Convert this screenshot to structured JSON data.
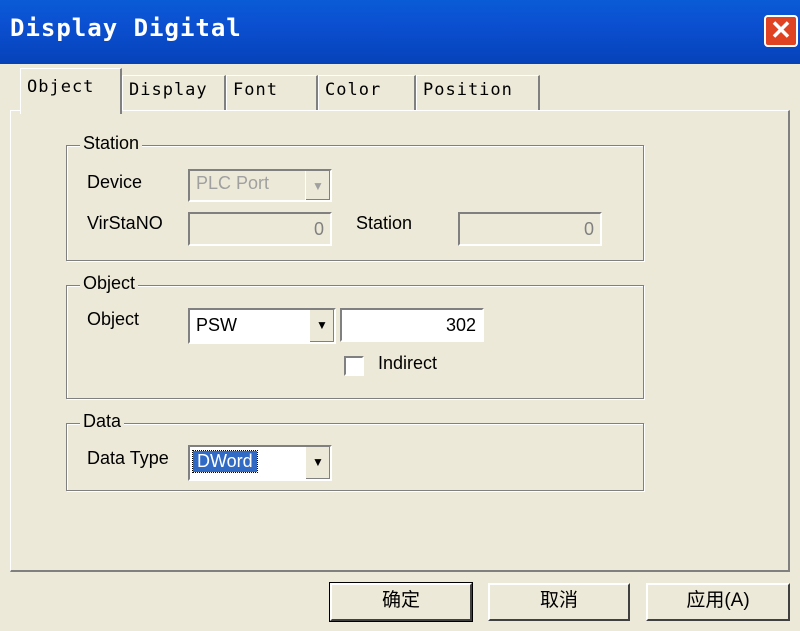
{
  "window": {
    "title": "Display Digital",
    "close_glyph": "✕"
  },
  "tabs": [
    {
      "label": "Object",
      "active": true
    },
    {
      "label": "Display",
      "active": false
    },
    {
      "label": "Font",
      "active": false
    },
    {
      "label": "Color",
      "active": false
    },
    {
      "label": "Position",
      "active": false
    }
  ],
  "station_group": {
    "legend": "Station",
    "device_label": "Device",
    "device_value": "PLC Port",
    "virstano_label": "VirStaNO",
    "virstano_value": "0",
    "station_label": "Station",
    "station_value": "0"
  },
  "object_group": {
    "legend": "Object",
    "object_label": "Object",
    "object_type": "PSW",
    "object_address": "302",
    "indirect_label": "Indirect",
    "indirect_checked": false
  },
  "data_group": {
    "legend": "Data",
    "data_type_label": "Data Type",
    "data_type_value": "DWord"
  },
  "buttons": {
    "ok": "确定",
    "cancel": "取消",
    "apply": "应用(A)"
  },
  "icons": {
    "dropdown": "chevron-down-icon",
    "close": "close-icon"
  },
  "colors": {
    "titlebar": "#0a5bd6",
    "close": "#e04321",
    "selection": "#316ac5",
    "face": "#ece9d8"
  }
}
